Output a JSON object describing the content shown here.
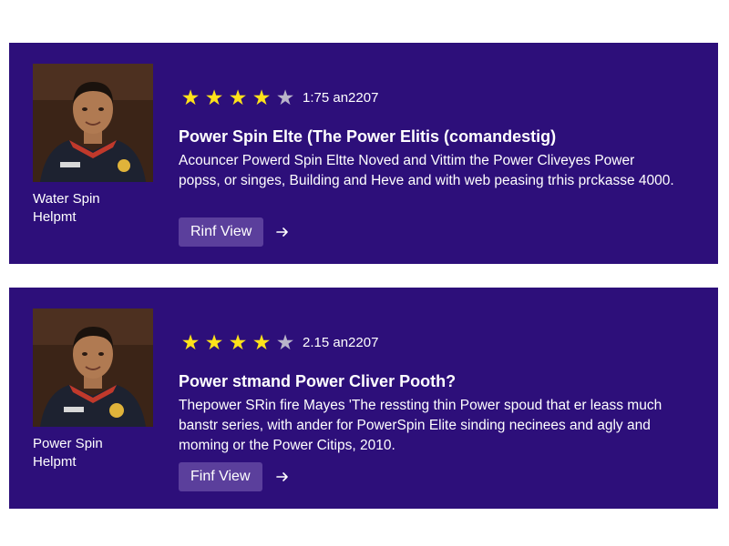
{
  "reviews": [
    {
      "user_name": "Water Spin\nHelpmt",
      "rating_stars": 4,
      "rating_max": 5,
      "rating_text": "1:75 an2207",
      "title": "Power Spin Elte (The Power Elitis (comandestig)",
      "description": "Acouncer Powerd Spin Eltte  Noved and Vittim the Power Cliveyes Power popss, or singes, Building and Heve and with web peasing trhis prckasse 4000.",
      "button_label": "Rinf View",
      "arrow_icon": "arrow-right-icon"
    },
    {
      "user_name": "Power Spin\nHelpmt",
      "rating_stars": 4,
      "rating_max": 5,
      "rating_text": "2.15 an2207",
      "title": "Power stmand Power Cliver Pooth?",
      "description": "Thepower SRin fire Mayes 'The ressting thin Power spoud that er leass much banstr series, with ander for PowerSpin Elite sinding necinees and agly and moming or the Power Citips, 2010.",
      "button_label": "Finf View",
      "arrow_icon": "arrow-right-icon"
    }
  ],
  "colors": {
    "card_background": "#2d0f7a",
    "star_filled": "#ffe21a",
    "star_empty": "#b9b4c9",
    "button_background": "#5b3f9c",
    "page_background": "#ffffff"
  }
}
